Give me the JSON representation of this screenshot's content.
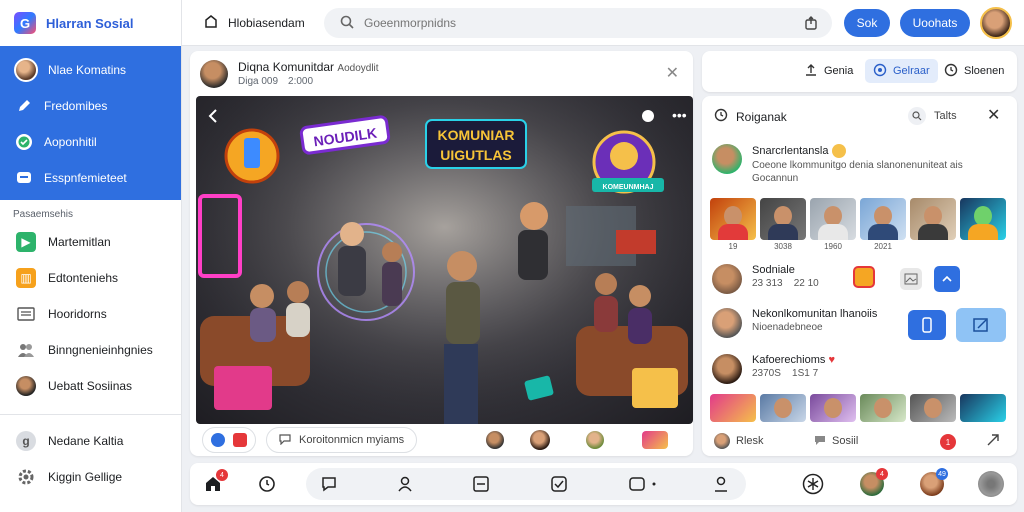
{
  "app": {
    "name": "Hlarran Sosial"
  },
  "sidebar": {
    "primary": [
      {
        "label": "Nlae Komatins"
      },
      {
        "label": "Fredomibes"
      },
      {
        "label": "Aoponhitil"
      },
      {
        "label": "Esspnfemieteet"
      }
    ],
    "section_label": "Pasaemsehis",
    "secondary": [
      {
        "label": "Martemitlan"
      },
      {
        "label": "Edtonteniehs"
      },
      {
        "label": "Hooridorns"
      },
      {
        "label": "Binngnenieinhgnies"
      },
      {
        "label": "Uebatt Sosiinas"
      }
    ],
    "footer": [
      {
        "label": "Nedane Kaltia"
      },
      {
        "label": "Kiggin Gellige"
      }
    ]
  },
  "topbar": {
    "title": "Hlobiasendam",
    "search_placeholder": "Goeenmorpnidns",
    "btn1": "Sok",
    "btn2": "Uoohats"
  },
  "post": {
    "author": "Diqna Komunitdar",
    "author_tag": "Aodoydlit",
    "time": "Diga 009",
    "time2": "2:000",
    "comment_label": "Koroitonmicn myiams"
  },
  "media": {
    "sign1": "NOUDILK",
    "sign2": "KOMUNIAR",
    "sign3": "UIGUTLAS",
    "badge": "KOMEUNMHAJ"
  },
  "right_top": {
    "b1": "Genia",
    "b2": "Gelraar",
    "b3": "Sloenen"
  },
  "right_main": {
    "title": "Roiganak",
    "tab": "Talts",
    "r1_name": "Snarcrlentansla",
    "r1_line": "Coeone lkommunitgo denia slanonenuniteat ais",
    "r1_sub": "Gocannun",
    "captions": [
      "19",
      "3038",
      "1960",
      "2021",
      ""
    ],
    "r2_name": "Sodniale",
    "r2_sub1": "23 313",
    "r2_sub2": "22 10",
    "r3_name": "Nekonlkomunitan lhanoiis",
    "r3_sub": "Nioenadebneoe",
    "r4_name": "Kafoerechioms",
    "r4_sub1": "2370S",
    "r4_sub2": "1S1 7",
    "foot_a": "Rlesk",
    "foot_b": "Sosiil",
    "foot_badge": "1"
  },
  "bottom": {
    "badge_home": "4",
    "badge_a": "4",
    "badge_b": "49"
  },
  "colors": {
    "accent": "#2f6fe0",
    "brand_text": "#2e5fd8",
    "badge_red": "#e5373a"
  }
}
